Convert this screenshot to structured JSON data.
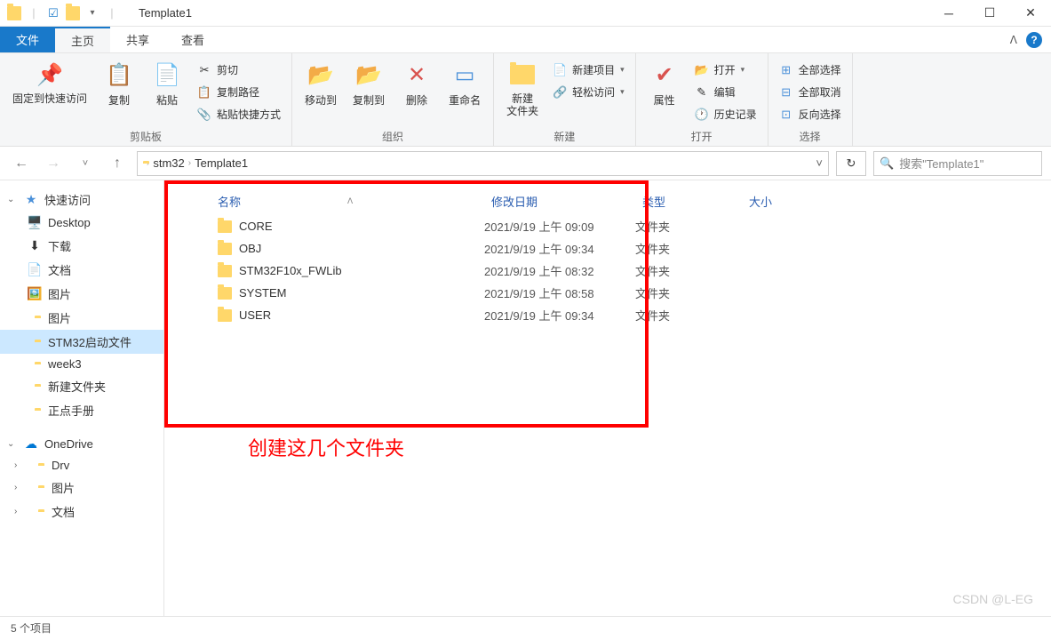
{
  "title": "Template1",
  "tabs": {
    "file": "文件",
    "home": "主页",
    "share": "共享",
    "view": "查看"
  },
  "ribbon": {
    "clipboard": {
      "label": "剪贴板",
      "pin": "固定到快速访问",
      "copy": "复制",
      "paste": "粘贴",
      "cut": "剪切",
      "copypath": "复制路径",
      "pasteshortcut": "粘贴快捷方式"
    },
    "organize": {
      "label": "组织",
      "moveto": "移动到",
      "copyto": "复制到",
      "delete": "删除",
      "rename": "重命名"
    },
    "new": {
      "label": "新建",
      "newfolder": "新建文件夹",
      "newitem": "新建项目",
      "easyaccess": "轻松访问"
    },
    "open": {
      "label": "打开",
      "properties": "属性",
      "open": "打开",
      "edit": "编辑",
      "history": "历史记录"
    },
    "select": {
      "label": "选择",
      "all": "全部选择",
      "none": "全部取消",
      "invert": "反向选择"
    }
  },
  "breadcrumb": [
    "stm32",
    "Template1"
  ],
  "search_placeholder": "搜索\"Template1\"",
  "sidebar": {
    "quickaccess": "快速访问",
    "items": [
      {
        "icon": "🖥️",
        "label": "Desktop"
      },
      {
        "icon": "⬇",
        "label": "下载"
      },
      {
        "icon": "📄",
        "label": "文档"
      },
      {
        "icon": "🖼️",
        "label": "图片"
      },
      {
        "icon": "📁",
        "label": "图片"
      },
      {
        "icon": "📁",
        "label": "STM32启动文件",
        "selected": true
      },
      {
        "icon": "📁",
        "label": "week3"
      },
      {
        "icon": "📁",
        "label": "新建文件夹"
      },
      {
        "icon": "📁",
        "label": "正点手册"
      }
    ],
    "onedrive": "OneDrive",
    "odItems": [
      {
        "icon": "📁",
        "label": "Drv"
      },
      {
        "icon": "📁",
        "label": "图片"
      },
      {
        "icon": "📁",
        "label": "文档"
      }
    ]
  },
  "columns": {
    "name": "名称",
    "date": "修改日期",
    "type": "类型",
    "size": "大小"
  },
  "rows": [
    {
      "name": "CORE",
      "date": "2021/9/19 上午 09:09",
      "type": "文件夹"
    },
    {
      "name": "OBJ",
      "date": "2021/9/19 上午 09:34",
      "type": "文件夹"
    },
    {
      "name": "STM32F10x_FWLib",
      "date": "2021/9/19 上午 08:32",
      "type": "文件夹"
    },
    {
      "name": "SYSTEM",
      "date": "2021/9/19 上午 08:58",
      "type": "文件夹"
    },
    {
      "name": "USER",
      "date": "2021/9/19 上午 09:34",
      "type": "文件夹"
    }
  ],
  "annotation": "创建这几个文件夹",
  "status": "5 个项目",
  "watermark": "CSDN @L-EG"
}
